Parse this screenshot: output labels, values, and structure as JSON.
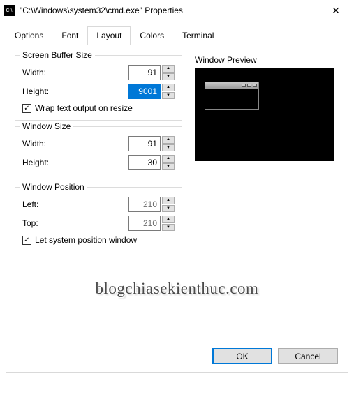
{
  "window": {
    "icon_text": "C:\\.",
    "title": "\"C:\\Windows\\system32\\cmd.exe\" Properties"
  },
  "tabs": {
    "options": "Options",
    "font": "Font",
    "layout": "Layout",
    "colors": "Colors",
    "terminal": "Terminal"
  },
  "screen_buffer": {
    "legend": "Screen Buffer Size",
    "width_label": "Width:",
    "width_value": "91",
    "height_label": "Height:",
    "height_value": "9001",
    "wrap_label": "Wrap text output on resize",
    "wrap_checked": true
  },
  "window_size": {
    "legend": "Window Size",
    "width_label": "Width:",
    "width_value": "91",
    "height_label": "Height:",
    "height_value": "30"
  },
  "window_position": {
    "legend": "Window Position",
    "left_label": "Left:",
    "left_value": "210",
    "top_label": "Top:",
    "top_value": "210",
    "auto_label": "Let system position window",
    "auto_checked": true
  },
  "preview": {
    "label": "Window Preview"
  },
  "watermark": "blogchiasekienthuc.com",
  "buttons": {
    "ok": "OK",
    "cancel": "Cancel"
  }
}
